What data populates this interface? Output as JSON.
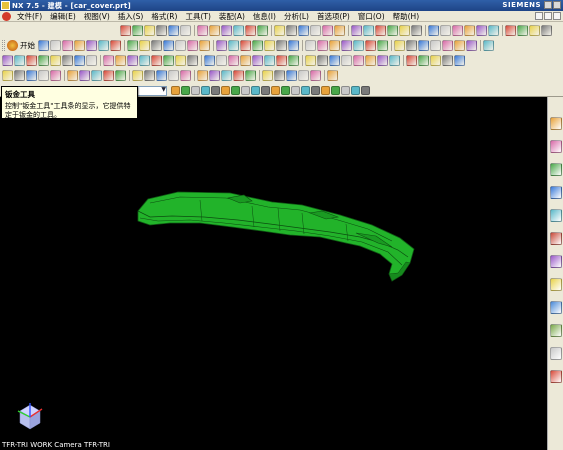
{
  "window": {
    "title": "NX 7.5 - 建模 - [car_cover.prt]",
    "brand": "SIEMENS"
  },
  "menu": {
    "items": [
      "文件(F)",
      "编辑(E)",
      "视图(V)",
      "插入(S)",
      "格式(R)",
      "工具(T)",
      "装配(A)",
      "信息(I)",
      "分析(L)",
      "首选项(P)",
      "窗口(O)",
      "帮助(H)"
    ]
  },
  "toolbar": {
    "start_label": "开始"
  },
  "tooltip": {
    "title": "钣金工具",
    "body": "控制\"钣金工具\"工具条的显示，它提供特定于钣金的工具。"
  },
  "viewport": {
    "view_label": "TFR-TRI WORK Camera TFR-TRI",
    "model_color": "#22b32a",
    "background": "#000000"
  },
  "icons": [
    "app-icon",
    "menu-logo-icon",
    "start-icon",
    "filter-dropdown-icon",
    "wcs-triad-icon"
  ]
}
